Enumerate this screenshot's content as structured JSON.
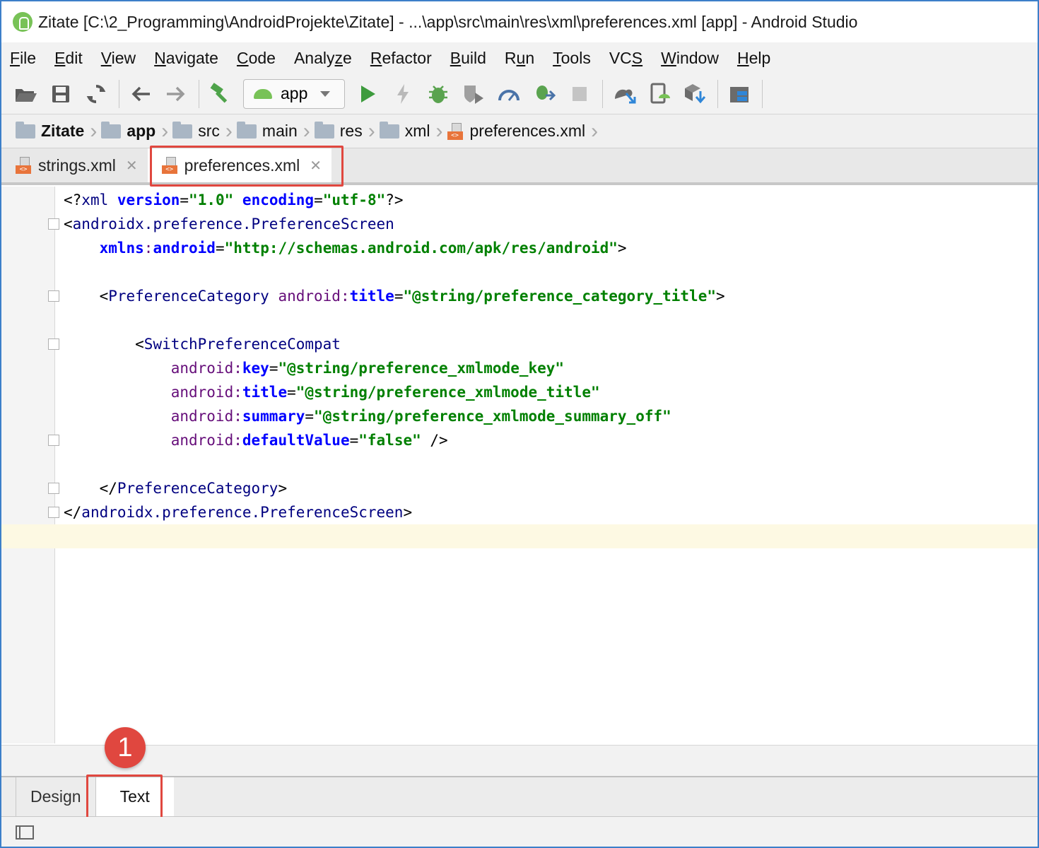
{
  "window": {
    "title": "Zitate [C:\\2_Programming\\AndroidProjekte\\Zitate] - ...\\app\\src\\main\\res\\xml\\preferences.xml [app] - Android Studio"
  },
  "menu": {
    "items": [
      {
        "mnemonic": "F",
        "rest": "ile"
      },
      {
        "mnemonic": "E",
        "rest": "dit"
      },
      {
        "mnemonic": "V",
        "rest": "iew"
      },
      {
        "mnemonic": "N",
        "rest": "avigate"
      },
      {
        "mnemonic": "C",
        "rest": "ode"
      },
      {
        "pre": "Analy",
        "mnemonic": "z",
        "rest": "e"
      },
      {
        "mnemonic": "R",
        "rest": "efactor"
      },
      {
        "mnemonic": "B",
        "rest": "uild"
      },
      {
        "pre": "R",
        "mnemonic": "u",
        "rest": "n"
      },
      {
        "mnemonic": "T",
        "rest": "ools"
      },
      {
        "pre": "VC",
        "mnemonic": "S",
        "rest": ""
      },
      {
        "mnemonic": "W",
        "rest": "indow"
      },
      {
        "mnemonic": "H",
        "rest": "elp"
      }
    ]
  },
  "toolbar": {
    "run_config": "app",
    "icons": [
      "open-icon",
      "save-icon",
      "sync-icon",
      "back-icon",
      "forward-icon",
      "make-project-icon",
      "run-icon",
      "apply-changes-icon",
      "debug-icon",
      "coverage-icon",
      "profile-icon",
      "attach-debugger-icon",
      "stop-icon",
      "gradle-sync-icon",
      "avd-manager-icon",
      "sdk-manager-icon",
      "project-structure-icon"
    ]
  },
  "breadcrumb": [
    "Zitate",
    "app",
    "src",
    "main",
    "res",
    "xml",
    "preferences.xml"
  ],
  "tabs": [
    {
      "label": "strings.xml",
      "active": false
    },
    {
      "label": "preferences.xml",
      "active": true
    }
  ],
  "code": {
    "lines": [
      [
        [
          "br",
          "<?"
        ],
        [
          "tag",
          "xml "
        ],
        [
          "attr",
          "version"
        ],
        [
          "br",
          "="
        ],
        [
          "val",
          "\"1.0\""
        ],
        [
          "br",
          " "
        ],
        [
          "attr",
          "encoding"
        ],
        [
          "br",
          "="
        ],
        [
          "val",
          "\"utf-8\""
        ],
        [
          "br",
          "?>"
        ]
      ],
      [
        [
          "br",
          "<"
        ],
        [
          "tag",
          "androidx.preference.PreferenceScreen"
        ]
      ],
      [
        [
          "br",
          "    "
        ],
        [
          "attr",
          "xmlns"
        ],
        [
          "ns",
          ":"
        ],
        [
          "attr",
          "android"
        ],
        [
          "br",
          "="
        ],
        [
          "val",
          "\"http://schemas.android.com/apk/res/android\""
        ],
        [
          "br",
          ">"
        ]
      ],
      [],
      [
        [
          "br",
          "    <"
        ],
        [
          "tag",
          "PreferenceCategory "
        ],
        [
          "ns",
          "android:"
        ],
        [
          "attr",
          "title"
        ],
        [
          "br",
          "="
        ],
        [
          "val",
          "\"@string/preference_category_title\""
        ],
        [
          "br",
          ">"
        ]
      ],
      [],
      [
        [
          "br",
          "        <"
        ],
        [
          "tag",
          "SwitchPreferenceCompat"
        ]
      ],
      [
        [
          "br",
          "            "
        ],
        [
          "ns",
          "android:"
        ],
        [
          "attr",
          "key"
        ],
        [
          "br",
          "="
        ],
        [
          "val",
          "\"@string/preference_xmlmode_key\""
        ]
      ],
      [
        [
          "br",
          "            "
        ],
        [
          "ns",
          "android:"
        ],
        [
          "attr",
          "title"
        ],
        [
          "br",
          "="
        ],
        [
          "val",
          "\"@string/preference_xmlmode_title\""
        ]
      ],
      [
        [
          "br",
          "            "
        ],
        [
          "ns",
          "android:"
        ],
        [
          "attr",
          "summary"
        ],
        [
          "br",
          "="
        ],
        [
          "val",
          "\"@string/preference_xmlmode_summary_off\""
        ]
      ],
      [
        [
          "br",
          "            "
        ],
        [
          "ns",
          "android:"
        ],
        [
          "attr",
          "defaultValue"
        ],
        [
          "br",
          "="
        ],
        [
          "val",
          "\"false\""
        ],
        [
          "br",
          " />"
        ]
      ],
      [],
      [
        [
          "br",
          "    </"
        ],
        [
          "tag",
          "PreferenceCategory"
        ],
        [
          "br",
          ">"
        ]
      ],
      [
        [
          "br",
          "</"
        ],
        [
          "tag",
          "androidx.preference.PreferenceScreen"
        ],
        [
          "br",
          ">"
        ]
      ],
      []
    ]
  },
  "bottom_tabs": [
    {
      "label": "Design",
      "active": false
    },
    {
      "label": "Text",
      "active": true
    }
  ],
  "annotation": {
    "badge": "1"
  },
  "colors": {
    "highlight": "#e0473f",
    "current_line": "#fdf9e3",
    "string_value": "#008000",
    "tag": "#000080",
    "attribute": "#0000ff"
  }
}
